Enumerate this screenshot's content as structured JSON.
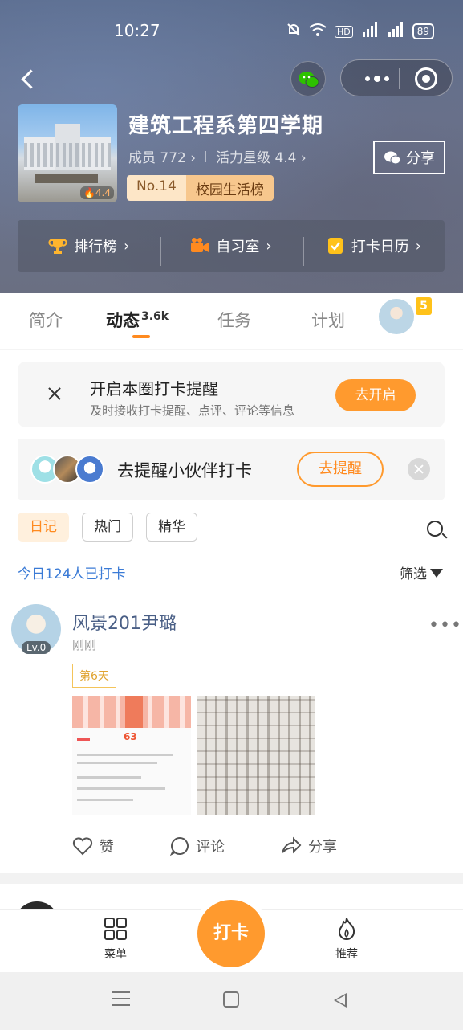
{
  "status": {
    "time": "10:27",
    "battery": "89"
  },
  "group": {
    "title": "建筑工程系第四学期",
    "members": "成员 772",
    "vitality": "活力星级 4.4",
    "cover_score": "4.4",
    "rank_no": "No.14",
    "rank_label": "校园生活榜",
    "share_label": "分享"
  },
  "quick_links": [
    {
      "label": "排行榜",
      "icon": "trophy-icon"
    },
    {
      "label": "自习室",
      "icon": "video-camera-icon"
    },
    {
      "label": "打卡日历",
      "icon": "calendar-check-icon"
    }
  ],
  "tabs": [
    {
      "label": "简介"
    },
    {
      "label": "动态",
      "count": "3.6k"
    },
    {
      "label": "任务"
    },
    {
      "label": "计划"
    }
  ],
  "tab_badge": "5",
  "reminder": {
    "title": "开启本圈打卡提醒",
    "subtitle": "及时接收打卡提醒、点评、评论等信息",
    "button": "去开启"
  },
  "partner": {
    "text": "去提醒小伙伴打卡",
    "button": "去提醒"
  },
  "filters": [
    {
      "label": "日记",
      "active": true
    },
    {
      "label": "热门"
    },
    {
      "label": "精华"
    }
  ],
  "today_count": "今日124人已打卡",
  "filter_label": "筛选",
  "post": {
    "author": "风景201尹璐",
    "time": "刚刚",
    "level": "Lv.0",
    "day_tag": "第6天",
    "img_score": "63",
    "actions": {
      "like": "赞",
      "comment": "评论",
      "share": "分享"
    }
  },
  "bottom_nav": {
    "menu": "菜单",
    "checkin": "打卡",
    "recommend": "推荐"
  },
  "colors": {
    "accent": "#ff9a2e",
    "link": "#3b7bd6",
    "author": "#4a5f86"
  }
}
